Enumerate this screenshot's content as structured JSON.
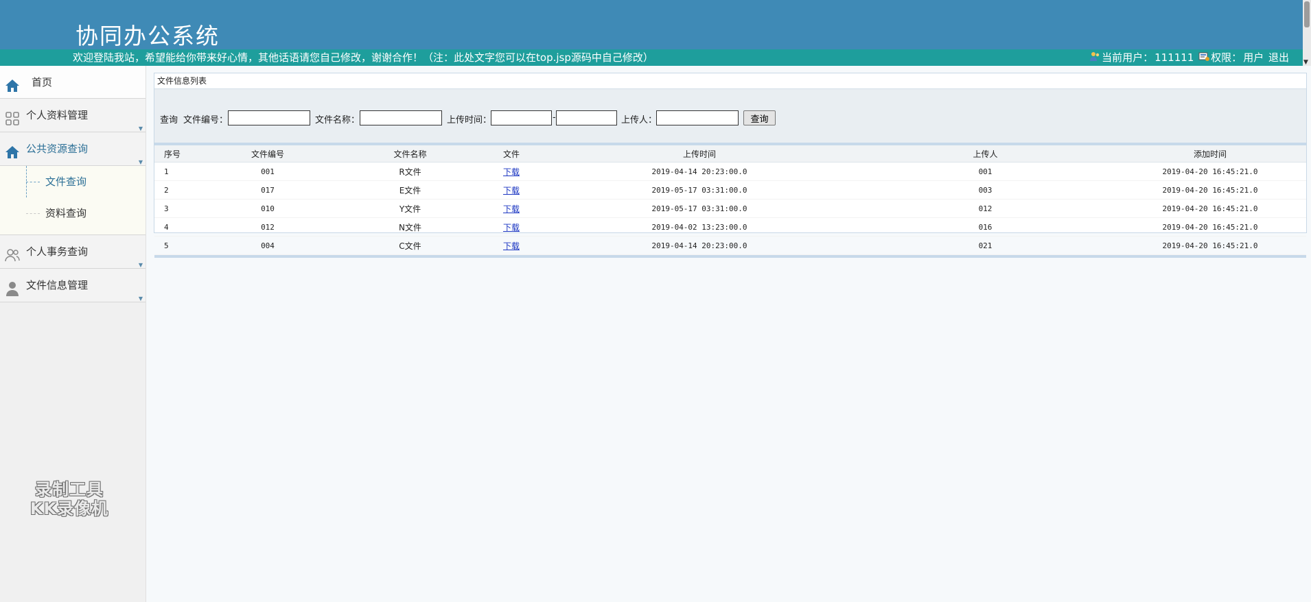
{
  "header": {
    "title": "协同办公系统",
    "welcome": "欢迎登陆我站，希望能给你带来好心情，其他话语请您自己修改，谢谢合作！（注：此处文字您可以在top.jsp源码中自己修改）",
    "current_user_label": "当前用户：",
    "current_user": "111111",
    "role_label": "权限：",
    "role": "用户",
    "logout": "退出"
  },
  "sidebar": {
    "items": [
      {
        "label": "首页",
        "icon": "home-icon"
      },
      {
        "label": "个人资料管理",
        "icon": "grid-icon"
      },
      {
        "label": "公共资源查询",
        "icon": "home-icon"
      },
      {
        "label": "个人事务查询",
        "icon": "users-icon"
      },
      {
        "label": "文件信息管理",
        "icon": "person-icon"
      }
    ],
    "sub_items": [
      {
        "label": "文件查询"
      },
      {
        "label": "资料查询"
      }
    ],
    "watermark_line1": "录制工具",
    "watermark_line2": "KK录像机"
  },
  "panel": {
    "title": "文件信息列表",
    "search": {
      "query_label": "查询",
      "file_no_label": "文件编号：",
      "file_name_label": "文件名称：",
      "upload_time_label": "上传时间：",
      "dash": "-",
      "uploader_label": "上传人：",
      "button": "查询",
      "file_no_value": "",
      "file_name_value": "",
      "time_from_value": "",
      "time_to_value": "",
      "uploader_value": ""
    },
    "columns": [
      "序号",
      "文件编号",
      "文件名称",
      "文件",
      "上传时间",
      "上传人",
      "添加时间"
    ],
    "rows": [
      {
        "idx": "1",
        "no": "001",
        "name": "R文件",
        "file": "下载",
        "upload_time": "2019-04-14 20:23:00.0",
        "uploader": "001",
        "added": "2019-04-20 16:45:21.0"
      },
      {
        "idx": "2",
        "no": "017",
        "name": "E文件",
        "file": "下载",
        "upload_time": "2019-05-17 03:31:00.0",
        "uploader": "003",
        "added": "2019-04-20 16:45:21.0"
      },
      {
        "idx": "3",
        "no": "010",
        "name": "Y文件",
        "file": "下载",
        "upload_time": "2019-05-17 03:31:00.0",
        "uploader": "012",
        "added": "2019-04-20 16:45:21.0"
      },
      {
        "idx": "4",
        "no": "012",
        "name": "N文件",
        "file": "下载",
        "upload_time": "2019-04-02 13:23:00.0",
        "uploader": "016",
        "added": "2019-04-20 16:45:21.0"
      },
      {
        "idx": "5",
        "no": "004",
        "name": "C文件",
        "file": "下载",
        "upload_time": "2019-04-14 20:23:00.0",
        "uploader": "021",
        "added": "2019-04-20 16:45:21.0"
      }
    ]
  },
  "colors": {
    "header_bg": "#3f8ab6",
    "welcome_bar": "#1e9e9c",
    "nav_active": "#2b6f96",
    "link": "#1a35c2"
  }
}
